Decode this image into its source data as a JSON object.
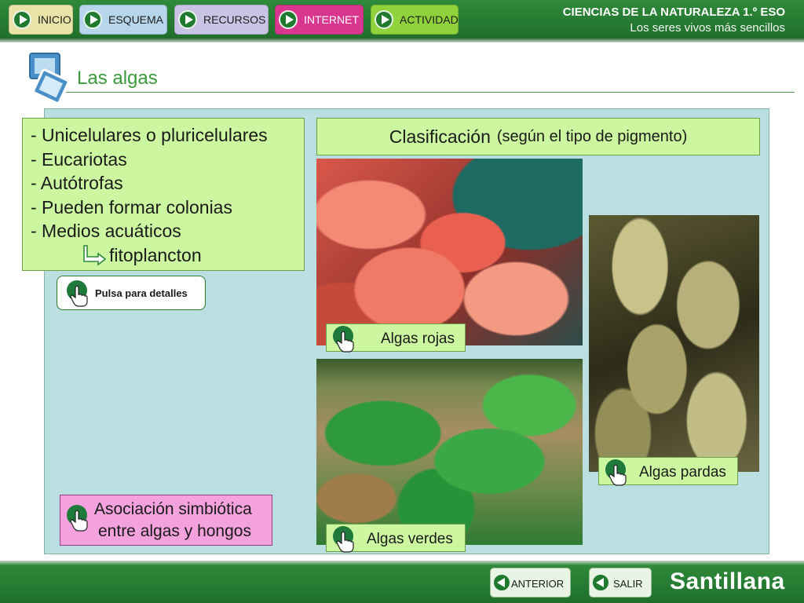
{
  "nav": {
    "inicio": "INICIO",
    "esquema": "ESQUEMA",
    "recursos": "RECURSOS",
    "internet": "INTERNET",
    "actividad": "ACTIVIDAD"
  },
  "course": {
    "title": "CIENCIAS DE LA NATURALEZA 1.º ESO",
    "subtitle": "Los seres vivos más sencillos"
  },
  "page": {
    "title": "Las algas"
  },
  "features": {
    "items": [
      "- Unicelulares o pluricelulares",
      "- Eucariotas",
      "- Autótrofas",
      "- Pueden formar colonias",
      "- Medios acuáticos"
    ],
    "sub": "fitoplancton"
  },
  "detail_button": "Pulsa para detalles",
  "classification": {
    "title": "Clasificación",
    "note": "(según el tipo de pigmento)"
  },
  "labels": {
    "rojas": "Algas rojas",
    "verdes": "Algas verdes",
    "pardas": "Algas pardas"
  },
  "symbiosis": {
    "line1": "Asociación simbiótica",
    "line2": "entre algas y hongos"
  },
  "footer": {
    "anterior": "ANTERIOR",
    "salir": "SALIR",
    "brand": "Santillana"
  },
  "colors": {
    "brand_green": "#2f8a3a",
    "box_green": "#ccf7a0",
    "panel_blue": "#b9dfe1",
    "symbiosis_pink": "#f3a2de"
  }
}
